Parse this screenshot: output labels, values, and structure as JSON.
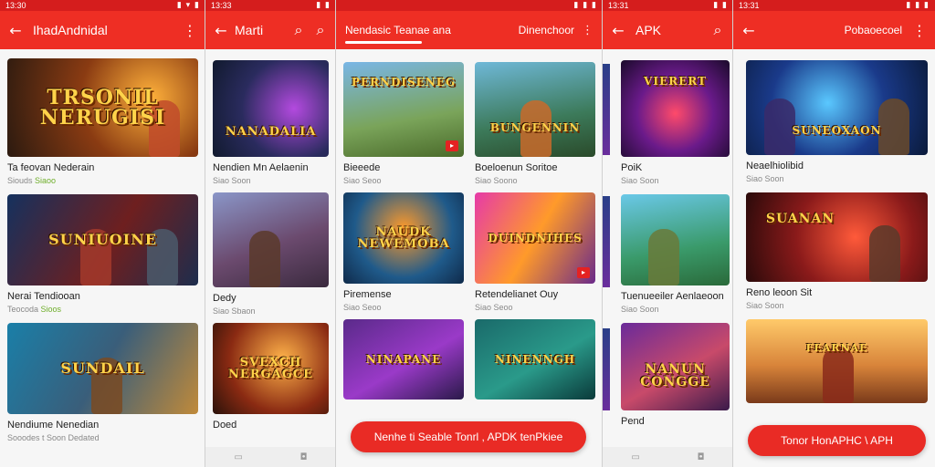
{
  "panels": [
    {
      "time": "13:30",
      "status_icons": "▮ ▾ ▮",
      "title": "IhadAndnidal",
      "cards": [
        {
          "name": "Ta feovan Nederain",
          "meta_pre": "Siouds",
          "meta_accent": "Siaoo"
        },
        {
          "name": "Nerai Tendiooan",
          "meta_pre": "Teocoda",
          "meta_accent": "Sioos"
        },
        {
          "name": "Nendiume Nenedian",
          "meta_pre": "Sooodes t Soon Dedated",
          "meta_accent": ""
        }
      ],
      "logos": [
        "TRSONIL NERUGISI",
        "SUNIUOINE",
        "SUNDAIL"
      ]
    },
    {
      "time": "13:33",
      "title": "Marti",
      "cards": [
        {
          "name": "Nendien Mn Aelaenin",
          "meta": "Siao Soon"
        },
        {
          "name": "Dedy",
          "meta": "Siao Sbaon"
        },
        {
          "name": "Doed",
          "meta": ""
        }
      ],
      "logos": [
        "NANADALIA",
        "",
        "SVEXCH NERGAGCE"
      ]
    },
    {
      "tab_active": "Nendasic Teanae ana",
      "tab_other": "Dinenchoor",
      "cards": [
        {
          "name": "Bieeede",
          "meta": "Siao Seoo"
        },
        {
          "name": "Boeloenun Soritoe",
          "meta": "Siao Soono"
        },
        {
          "name": "Piremense",
          "meta": "Siao Seoo"
        },
        {
          "name": "Retendelianet Ouy",
          "meta": "Siao Seoo"
        },
        {
          "name": "",
          "meta": ""
        },
        {
          "name": "",
          "meta": ""
        }
      ],
      "logos": [
        "PERNDISENEG",
        "BUNGENNIN",
        "NAUDK NEWEMOBA",
        "DUINDNIHES",
        "NINAPANE",
        "NINENNGH"
      ],
      "cta": "Nenhe ti Seable Tonrl , APDK tenPkiee"
    },
    {
      "time": "13:31",
      "title": "APK",
      "cards": [
        {
          "name": "PoiK",
          "meta": "Siao Soon"
        },
        {
          "name": "Tuenueeiler Aenlaeoon",
          "meta": "Siao Soon"
        },
        {
          "name": "Pend",
          "meta": ""
        }
      ],
      "logos": [
        "VIERERT",
        "",
        "NANUN CONGGE"
      ]
    },
    {
      "time": "13:31",
      "title": "Pobaoecoel",
      "cards": [
        {
          "name": "Neaelhiolibid",
          "meta": "Siao Soon"
        },
        {
          "name": "Reno leoon Sit",
          "meta": "Siao Soon"
        },
        {
          "name": "",
          "meta": ""
        }
      ],
      "logos": [
        "SUNEOXAON",
        "SUANAN",
        "FEARNAE"
      ],
      "cta": "Tonor HonAPHC \\ APH"
    }
  ],
  "icons": {
    "back": "back-arrow-icon",
    "more": "more-vert-icon",
    "search": "search-icon"
  },
  "colors": {
    "appbar": "#ee2e24",
    "status": "#d51d1d",
    "accent_green": "#6fae2b"
  }
}
